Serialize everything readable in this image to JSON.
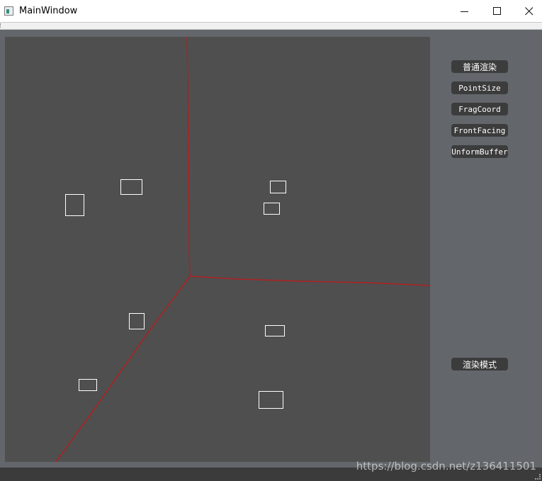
{
  "window": {
    "title": "MainWindow",
    "minimize_icon": "minimize-icon",
    "maximize_icon": "maximize-icon",
    "close_icon": "close-icon"
  },
  "sidebar": {
    "buttons": [
      {
        "label": "普通渲染"
      },
      {
        "label": "PointSize"
      },
      {
        "label": "FragCoord"
      },
      {
        "label": "FrontFacing"
      },
      {
        "label": "UnformBuffer"
      }
    ],
    "mode_button": {
      "label": "渲染模式"
    }
  },
  "canvas": {
    "background": "#4f4f4f",
    "line_color": "#b02020",
    "rect_color": "#ffffff"
  },
  "watermark": {
    "text": "https://blog.csdn.net/z136411501"
  }
}
